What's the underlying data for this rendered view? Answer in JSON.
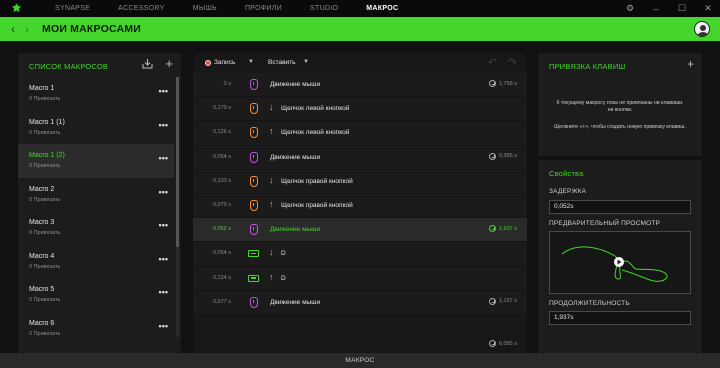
{
  "topnav": {
    "tabs": [
      "SYNAPSE",
      "ACCESSORY",
      "МЫШЬ",
      "ПРОФИЛИ",
      "STUDIO",
      "МАКРОС"
    ],
    "active_tab": "МАКРОС"
  },
  "header": {
    "title": "МОИ МАКРОСАМИ"
  },
  "macro_list": {
    "title": "СПИСОК МАКРОСОВ",
    "items": [
      {
        "name": "Macro 1",
        "sub": "0 Привязать"
      },
      {
        "name": "Macro 1 (1)",
        "sub": "0 Привязать"
      },
      {
        "name": "Macro 1 (2)",
        "sub": "0 Привязать"
      },
      {
        "name": "Macro 2",
        "sub": "0 Привязать"
      },
      {
        "name": "Macro 3",
        "sub": "0 Привязать"
      },
      {
        "name": "Macro 4",
        "sub": "0 Привязать"
      },
      {
        "name": "Macro 5",
        "sub": "0 Привязать"
      },
      {
        "name": "Macro 6",
        "sub": "0 Привязать"
      }
    ],
    "selected_index": 2
  },
  "editor": {
    "record_label": "Запись",
    "insert_label": "Вставить",
    "steps": [
      {
        "delay": "0 s",
        "icon": "mouse-purple",
        "dir": "",
        "label": "Движение мыши",
        "duration": "1,758 s"
      },
      {
        "delay": "0,179 s",
        "icon": "mouse-orange",
        "dir": "↓",
        "label": "Щелчок левой кнопкой",
        "duration": ""
      },
      {
        "delay": "0,126 s",
        "icon": "mouse-orange",
        "dir": "↑",
        "label": "Щелчок левой кнопкой",
        "duration": ""
      },
      {
        "delay": "0,054 s",
        "icon": "mouse-purple",
        "dir": "",
        "label": "Движение мыши",
        "duration": "0,385 s"
      },
      {
        "delay": "0,103 s",
        "icon": "mouse-orange",
        "dir": "↓",
        "label": "Щелчок правой кнопкой",
        "duration": ""
      },
      {
        "delay": "0,079 s",
        "icon": "mouse-orange",
        "dir": "↑",
        "label": "Щелчок правой кнопкой",
        "duration": ""
      },
      {
        "delay": "0,052 s",
        "icon": "mouse-purple",
        "dir": "",
        "label": "Движение мыши",
        "duration": "1,937 s"
      },
      {
        "delay": "0,054 s",
        "icon": "keyboard-green",
        "dir": "↓",
        "label": "D",
        "duration": ""
      },
      {
        "delay": "0,124 s",
        "icon": "keyboard-green",
        "dir": "↑",
        "label": "D",
        "duration": ""
      },
      {
        "delay": "0,077 s",
        "icon": "mouse-purple",
        "dir": "",
        "label": "Движение мыши",
        "duration": "1,157 s"
      }
    ],
    "selected_step": 6,
    "total_duration": "6,085 s"
  },
  "key_binding": {
    "title": "ПРИВЯЗКА КЛАВИШ",
    "text_line1": "К текущему макросу пока не привязаны ни клавиши,",
    "text_line2": "ни кнопки.",
    "text_line3": "Щелкните «+», чтобы создать новую привязку клавиш."
  },
  "properties": {
    "title": "Свойства",
    "delay_label": "ЗАДЕРЖКА",
    "delay_value": "0,052s",
    "preview_label": "ПРЕДВАРИТЕЛЬНЫЙ ПРОСМОТР",
    "duration_label": "ПРОДОЛЖИТЕЛЬНОСТЬ",
    "duration_value": "1,937s"
  },
  "footer": {
    "label": "МАКРОС"
  },
  "colors": {
    "accent": "#44d62c",
    "mouse_move": "#c050e8",
    "mouse_click": "#ff8c28"
  }
}
